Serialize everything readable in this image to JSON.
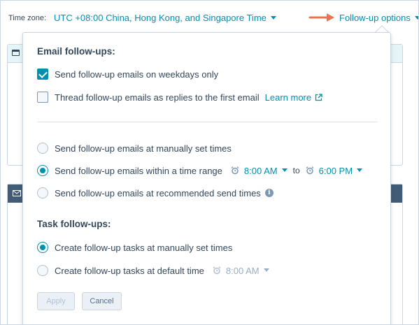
{
  "topbar": {
    "timezone_label": "Time zone:",
    "timezone_value": "UTC +08:00 China, Hong Kong, and Singapore Time",
    "followup_link": "Follow-up options"
  },
  "email_followups": {
    "title": "Email follow-ups:",
    "weekdays_only": {
      "label": "Send follow-up emails on weekdays only",
      "checked": true
    },
    "thread_replies": {
      "label": "Thread follow-up emails as replies to the first email",
      "checked": false
    },
    "learn_more": "Learn more",
    "options": [
      {
        "label": "Send follow-up emails at manually set times",
        "selected": false
      },
      {
        "label": "Send follow-up emails within a time range",
        "selected": true
      },
      {
        "label": "Send follow-up emails at recommended send times",
        "selected": false
      }
    ],
    "range_start": "8:00 AM",
    "range_to": "to",
    "range_end": "6:00 PM"
  },
  "task_followups": {
    "title": "Task follow-ups:",
    "options": [
      {
        "label": "Create follow-up tasks at manually set times",
        "selected": true
      },
      {
        "label": "Create follow-up tasks at default time",
        "selected": false
      }
    ],
    "default_time": "8:00 AM"
  },
  "buttons": {
    "apply": "Apply",
    "cancel": "Cancel"
  },
  "colors": {
    "accent": "#0091ae",
    "arrow": "#e8754f",
    "text": "#33475b",
    "dark_header": "#425b76"
  }
}
